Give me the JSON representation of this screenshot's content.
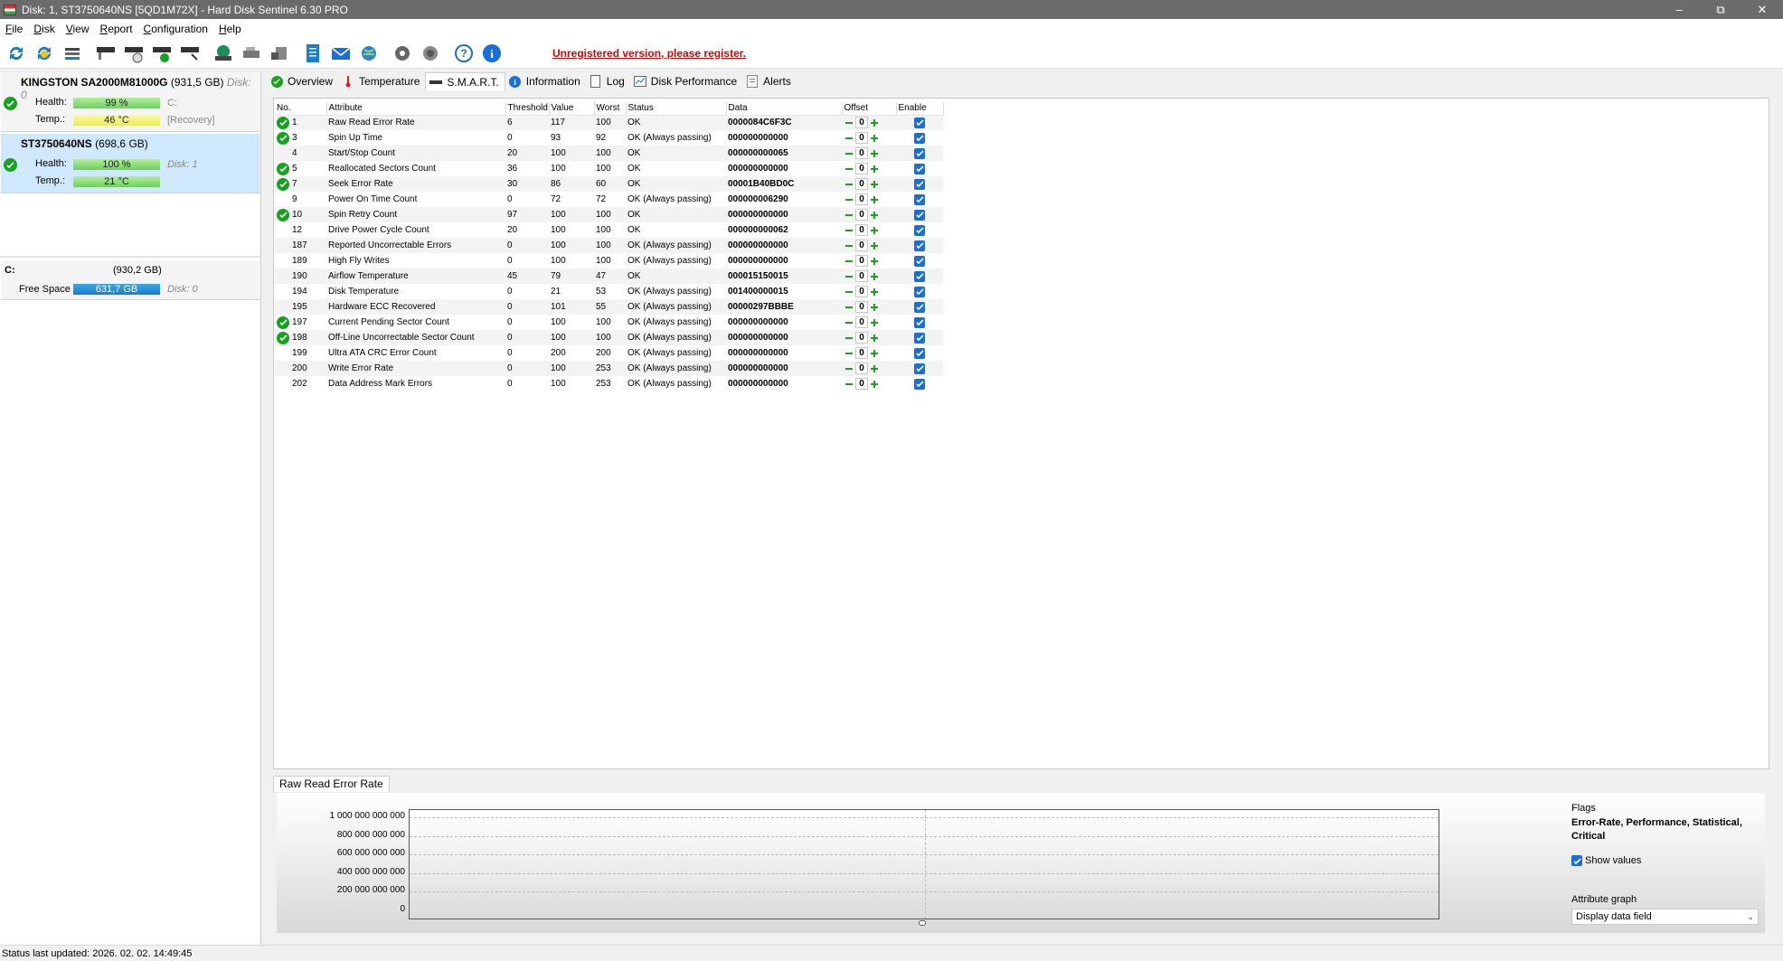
{
  "window": {
    "title": "Disk: 1, ST3750640NS [5QD1M72X]  -  Hard Disk Sentinel 6.30 PRO"
  },
  "menu": {
    "items": [
      {
        "label": "File"
      },
      {
        "label": "Disk"
      },
      {
        "label": "View"
      },
      {
        "label": "Report"
      },
      {
        "label": "Configuration"
      },
      {
        "label": "Help"
      }
    ]
  },
  "toolbar": {
    "notice": "Unregistered version, please register.",
    "icons": [
      "refresh-icon",
      "refresh-warning-icon",
      "drive-list-icon",
      "disk-test-icon",
      "disk-schedule-icon",
      "disk-ok-icon",
      "disk-surface-icon",
      "network-icon",
      "disk-tools-icon",
      "disk-backup-icon",
      "report-icon",
      "email-icon",
      "web-icon",
      "settings-icon",
      "sound-icon",
      "help-icon",
      "info-icon"
    ]
  },
  "disks": [
    {
      "name": "KINGSTON SA2000M81000G",
      "size": "(931,5 GB)",
      "disk_no": "Disk: 0",
      "health_label": "Health:",
      "health": "99 %",
      "temp_label": "Temp.:",
      "temp": "46 °C",
      "drive_letter": "C:",
      "note": "[Recovery]",
      "health_fraction": 0.99
    },
    {
      "name": "ST3750640NS",
      "size": "(698,6 GB)",
      "disk_no": "Disk: 1",
      "health_label": "Health:",
      "health": "100 %",
      "temp_label": "Temp.:",
      "temp": "21 °C",
      "health_fraction": 1.0
    }
  ],
  "volume": {
    "letter": "C:",
    "size": "(930,2 GB)",
    "free_label": "Free Space",
    "free": "631,7 GB",
    "disk_no": "Disk: 0"
  },
  "tabs": [
    {
      "label": "Overview"
    },
    {
      "label": "Temperature"
    },
    {
      "label": "S.M.A.R.T."
    },
    {
      "label": "Information"
    },
    {
      "label": "Log"
    },
    {
      "label": "Disk Performance"
    },
    {
      "label": "Alerts"
    }
  ],
  "smart_table": {
    "columns": [
      "No.",
      "Attribute",
      "Threshold",
      "Value",
      "Worst",
      "Status",
      "Data",
      "Offset",
      "Enable"
    ],
    "rows": [
      {
        "no": "1",
        "ok": true,
        "attr": "Raw Read Error Rate",
        "thr": "6",
        "val": "117",
        "worst": "100",
        "status": "OK",
        "data": "0000084C6F3C",
        "offset": "0"
      },
      {
        "no": "3",
        "ok": true,
        "attr": "Spin Up Time",
        "thr": "0",
        "val": "93",
        "worst": "92",
        "status": "OK (Always passing)",
        "data": "000000000000",
        "offset": "0"
      },
      {
        "no": "4",
        "ok": false,
        "attr": "Start/Stop Count",
        "thr": "20",
        "val": "100",
        "worst": "100",
        "status": "OK",
        "data": "000000000065",
        "offset": "0"
      },
      {
        "no": "5",
        "ok": true,
        "attr": "Reallocated Sectors Count",
        "thr": "36",
        "val": "100",
        "worst": "100",
        "status": "OK",
        "data": "000000000000",
        "offset": "0"
      },
      {
        "no": "7",
        "ok": true,
        "attr": "Seek Error Rate",
        "thr": "30",
        "val": "86",
        "worst": "60",
        "status": "OK",
        "data": "00001B40BD0C",
        "offset": "0"
      },
      {
        "no": "9",
        "ok": false,
        "attr": "Power On Time Count",
        "thr": "0",
        "val": "72",
        "worst": "72",
        "status": "OK (Always passing)",
        "data": "000000006290",
        "offset": "0"
      },
      {
        "no": "10",
        "ok": true,
        "attr": "Spin Retry Count",
        "thr": "97",
        "val": "100",
        "worst": "100",
        "status": "OK",
        "data": "000000000000",
        "offset": "0"
      },
      {
        "no": "12",
        "ok": false,
        "attr": "Drive Power Cycle Count",
        "thr": "20",
        "val": "100",
        "worst": "100",
        "status": "OK",
        "data": "000000000062",
        "offset": "0"
      },
      {
        "no": "187",
        "ok": false,
        "attr": "Reported Uncorrectable Errors",
        "thr": "0",
        "val": "100",
        "worst": "100",
        "status": "OK (Always passing)",
        "data": "000000000000",
        "offset": "0"
      },
      {
        "no": "189",
        "ok": false,
        "attr": "High Fly Writes",
        "thr": "0",
        "val": "100",
        "worst": "100",
        "status": "OK (Always passing)",
        "data": "000000000000",
        "offset": "0"
      },
      {
        "no": "190",
        "ok": false,
        "attr": "Airflow Temperature",
        "thr": "45",
        "val": "79",
        "worst": "47",
        "status": "OK",
        "data": "000015150015",
        "offset": "0"
      },
      {
        "no": "194",
        "ok": false,
        "attr": "Disk Temperature",
        "thr": "0",
        "val": "21",
        "worst": "53",
        "status": "OK (Always passing)",
        "data": "001400000015",
        "offset": "0"
      },
      {
        "no": "195",
        "ok": false,
        "attr": "Hardware ECC Recovered",
        "thr": "0",
        "val": "101",
        "worst": "55",
        "status": "OK (Always passing)",
        "data": "00000297BBBE",
        "offset": "0"
      },
      {
        "no": "197",
        "ok": true,
        "attr": "Current Pending Sector Count",
        "thr": "0",
        "val": "100",
        "worst": "100",
        "status": "OK (Always passing)",
        "data": "000000000000",
        "offset": "0"
      },
      {
        "no": "198",
        "ok": true,
        "attr": "Off-Line Uncorrectable Sector Count",
        "thr": "0",
        "val": "100",
        "worst": "100",
        "status": "OK (Always passing)",
        "data": "000000000000",
        "offset": "0"
      },
      {
        "no": "199",
        "ok": false,
        "attr": "Ultra ATA CRC Error Count",
        "thr": "0",
        "val": "200",
        "worst": "200",
        "status": "OK (Always passing)",
        "data": "000000000000",
        "offset": "0"
      },
      {
        "no": "200",
        "ok": false,
        "attr": "Write Error Rate",
        "thr": "0",
        "val": "100",
        "worst": "253",
        "status": "OK (Always passing)",
        "data": "000000000000",
        "offset": "0"
      },
      {
        "no": "202",
        "ok": false,
        "attr": "Data Address Mark Errors",
        "thr": "0",
        "val": "100",
        "worst": "253",
        "status": "OK (Always passing)",
        "data": "000000000000",
        "offset": "0"
      }
    ]
  },
  "graph": {
    "tab_label": "Raw Read Error Rate",
    "yticks": [
      "1 000 000 000 000",
      "800 000 000 000",
      "600 000 000 000",
      "400 000 000 000",
      "200 000 000 000",
      "0"
    ],
    "flags_label": "Flags",
    "flags_value": "Error-Rate, Performance, Statistical, Critical",
    "show_values_label": "Show values",
    "attr_graph_label": "Attribute graph",
    "attr_graph_value": "Display data field"
  },
  "status": {
    "text": "Status last updated: 2026. 02. 02. 14:49:45"
  },
  "colors": {
    "ok_green": "#15a31e",
    "notice_red": "#e00000",
    "selection_blue": "#cfe8fb",
    "free_space_blue": "#1a7dc7"
  }
}
